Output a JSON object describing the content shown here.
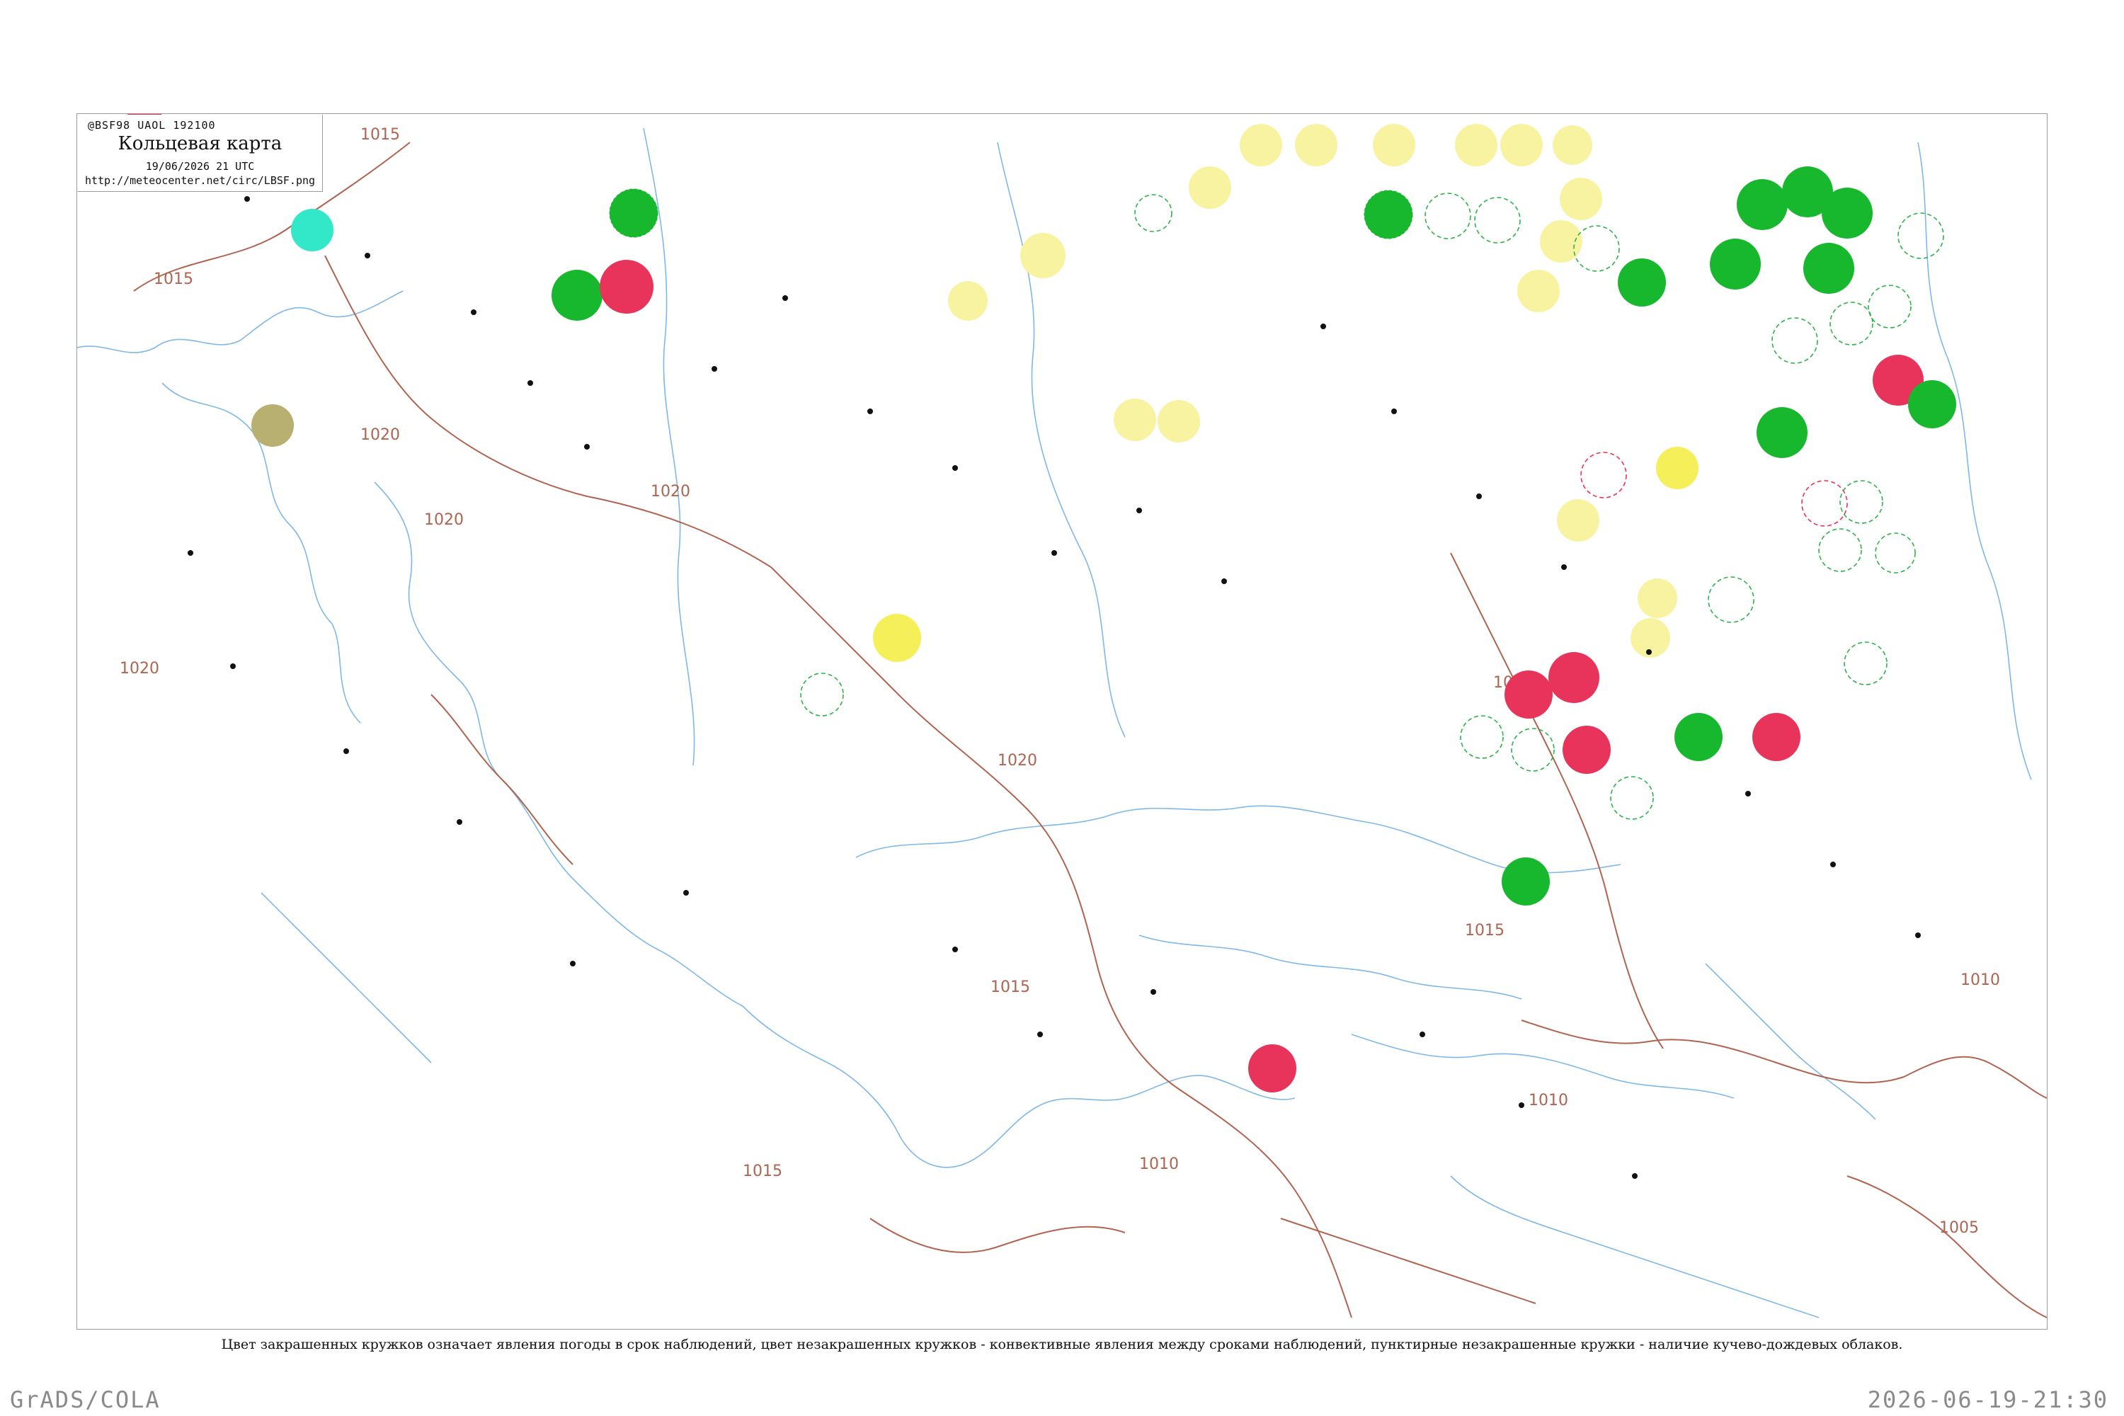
{
  "header": {
    "code": "@BSF98  UAOL  192100",
    "title": "Кольцевая карта",
    "datetime": "19/06/2026 21 UTC",
    "url": "http://meteocenter.net/circ/LBSF.png"
  },
  "isobars": [
    {
      "label": "1015"
    },
    {
      "label": "1015"
    },
    {
      "label": "1020"
    },
    {
      "label": "1020"
    },
    {
      "label": "1020"
    },
    {
      "label": "1020"
    },
    {
      "label": "1020"
    },
    {
      "label": "1015"
    },
    {
      "label": "1015"
    },
    {
      "label": "1015"
    },
    {
      "label": "1010"
    },
    {
      "label": "1010"
    },
    {
      "label": "1010"
    },
    {
      "label": "1005"
    },
    {
      "label": "1015"
    }
  ],
  "colors": {
    "coastline": "#7fb8e8",
    "isobar": "#b06450",
    "weather_red": "#e8345a",
    "weather_green": "#17b82e",
    "weather_yellow": "#f5f05a",
    "weather_paleyellow": "#f8f3a0",
    "weather_cyan": "#33e8c8",
    "weather_olive": "#b8b070",
    "convective_dashed": "#2fb34a"
  },
  "caption": "Цвет закрашенных кружков означает явления погоды в срок наблюдений, цвет незакрашенных кружков - конвективные явления между сроками наблюдений, пунктирные незакрашенные кружки - наличие кучево-дождевых облаков.",
  "footer": {
    "software": "GrADS/COLA",
    "timestamp": "2026-06-19-21:30"
  }
}
